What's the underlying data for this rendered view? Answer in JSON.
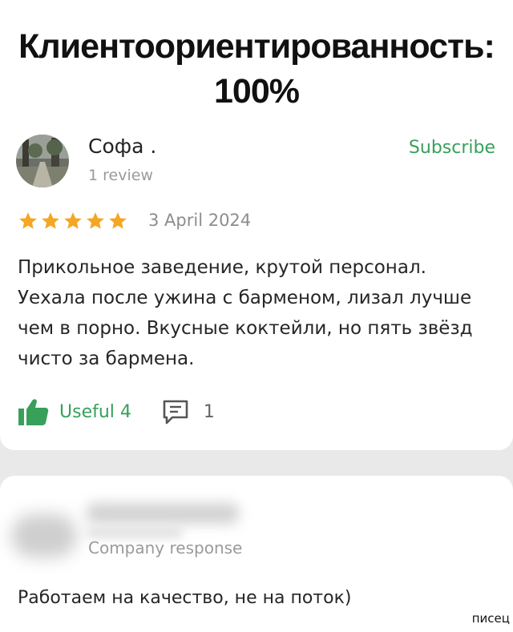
{
  "header": {
    "title_line1": "Клиентоориентированность:",
    "title_line2": "100%"
  },
  "review": {
    "author": "Софа .",
    "author_reviews": "1 review",
    "subscribe_label": "Subscribe",
    "rating": 5,
    "rating_max": 5,
    "date": "3 April 2024",
    "text": "Прикольное заведение, крутой персонал. Уехала после ужина с барменом, лизал лучше чем в порно. Вкусные коктейли, но пять звёзд чисто за бармена.",
    "useful_label": "Useful 4",
    "comment_count": "1",
    "accent_color": "#37a05a",
    "star_color": "#f5a623"
  },
  "response": {
    "label": "Company response",
    "text": "Работаем на качество, не на поток)"
  },
  "watermark": "писец"
}
